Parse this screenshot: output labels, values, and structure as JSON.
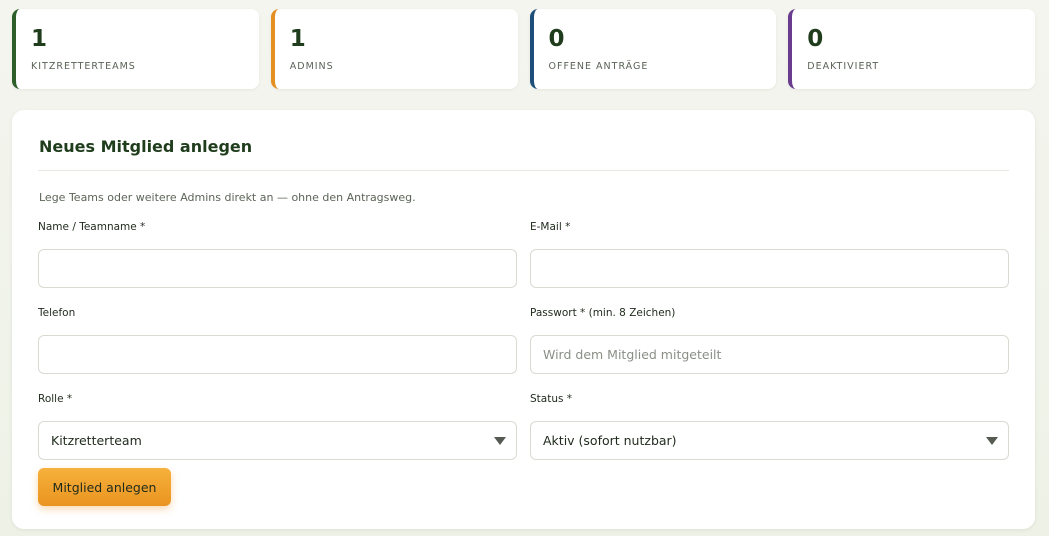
{
  "stats": [
    {
      "value": "1",
      "label": "KITZRETTERTEAMS",
      "color": "#2e5e2a"
    },
    {
      "value": "1",
      "label": "ADMINS",
      "color": "#e38f22"
    },
    {
      "value": "0",
      "label": "OFFENE ANTRÄGE",
      "color": "#1e4e7a"
    },
    {
      "value": "0",
      "label": "DEAKTIVIERT",
      "color": "#6a3c8f"
    }
  ],
  "form": {
    "title": "Neues Mitglied anlegen",
    "description": "Lege Teams oder weitere Admins direkt an — ohne den Antragsweg.",
    "name": {
      "label": "Name / Teamname *",
      "value": "",
      "placeholder": ""
    },
    "email": {
      "label": "E-Mail *",
      "value": "",
      "placeholder": ""
    },
    "phone": {
      "label": "Telefon",
      "value": "",
      "placeholder": ""
    },
    "password": {
      "label": "Passwort * (min. 8 Zeichen)",
      "value": "",
      "placeholder": "Wird dem Mitglied mitgeteilt"
    },
    "role": {
      "label": "Rolle *",
      "selected": "Kitzretterteam"
    },
    "status": {
      "label": "Status *",
      "selected": "Aktiv (sofort nutzbar)"
    },
    "submit_label": "Mitglied anlegen"
  },
  "icons": {
    "select_caret": "chevron-down-icon"
  },
  "colors": {
    "accent": "#ea9420",
    "heading": "#1f3d1c"
  }
}
